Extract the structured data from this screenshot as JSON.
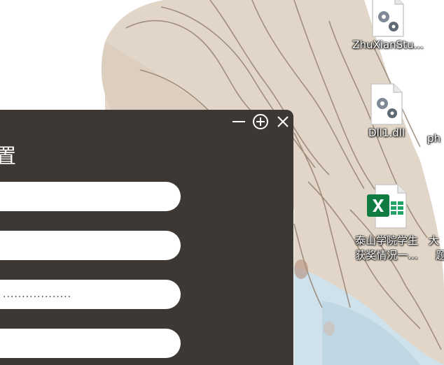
{
  "desktop": {
    "icons": [
      {
        "label": "ZhuXianStu...",
        "icon": "settings-file-icon"
      },
      {
        "label": "Dll1.dll",
        "icon": "settings-file-icon"
      },
      {
        "label": "ph",
        "icon": ""
      },
      {
        "label_line1": "泰山学院学生",
        "label_line2": "获奖情况一...",
        "icon": "excel-icon"
      },
      {
        "label_line1": "大",
        "label_line2": "题"
      }
    ]
  },
  "dialog": {
    "title": "置",
    "fields": [
      {
        "value": "",
        "type": "text"
      },
      {
        "value": "",
        "type": "text"
      },
      {
        "value": "..................",
        "type": "password"
      },
      {
        "value": "",
        "type": "text"
      }
    ],
    "controls": [
      "minimize-icon",
      "maximize-icon",
      "close-icon"
    ],
    "background_color": "#3d3833"
  }
}
